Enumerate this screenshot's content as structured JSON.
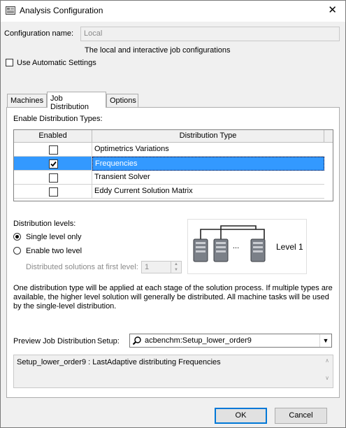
{
  "window": {
    "title": "Analysis Configuration",
    "close_glyph": "✕"
  },
  "config": {
    "name_label": "Configuration name:",
    "name_value": "Local",
    "description": "The local and interactive job configurations",
    "auto_settings_label": "Use Automatic Settings"
  },
  "tabs": [
    {
      "label": "Machines"
    },
    {
      "label": "Job Distribution"
    },
    {
      "label": "Options"
    }
  ],
  "distribution": {
    "enable_types_label": "Enable Distribution Types:",
    "columns": [
      "Enabled",
      "Distribution Type"
    ],
    "rows": [
      {
        "enabled": false,
        "type": "Optimetrics Variations"
      },
      {
        "enabled": true,
        "type": "Frequencies"
      },
      {
        "enabled": false,
        "type": "Transient Solver"
      },
      {
        "enabled": false,
        "type": "Eddy Current Solution Matrix"
      }
    ],
    "levels_label": "Distribution levels:",
    "single_level": "Single level only",
    "two_level": "Enable two level",
    "first_level_label": "Distributed solutions at first level:",
    "first_level_value": "1",
    "diagram_ellipsis": "...",
    "diagram_level": "Level 1",
    "info_text": "One distribution type will be applied at each stage of the solution process. If multiple types are available, the higher level solution will generally be distributed. All machine tasks will be used by the single-level distribution."
  },
  "preview": {
    "label": "Preview Job Distribution",
    "setup_label": "Setup:",
    "setup_value": "acbenchm:Setup_lower_order9",
    "result_text": "Setup_lower_order9 : LastAdaptive distributing Frequencies"
  },
  "buttons": {
    "ok": "OK",
    "cancel": "Cancel"
  }
}
